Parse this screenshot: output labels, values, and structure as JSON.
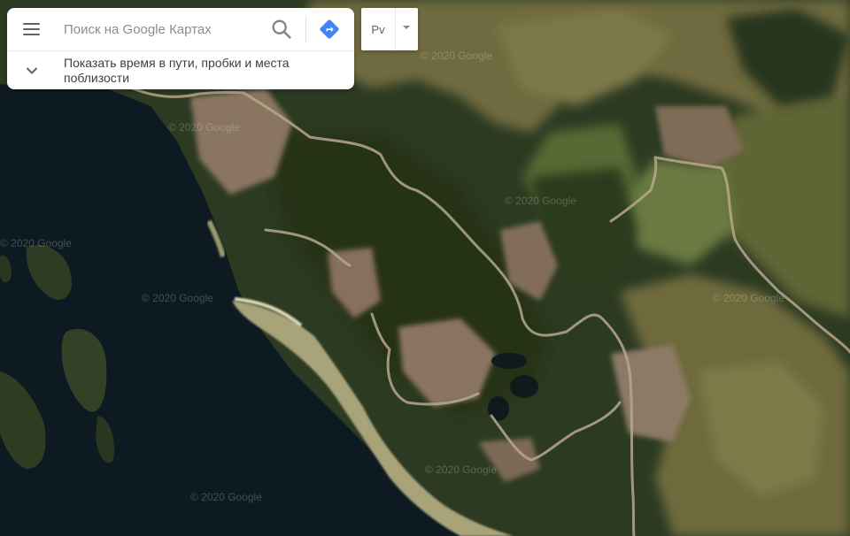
{
  "search": {
    "placeholder": "Поиск на Google Картах"
  },
  "suggestion": {
    "text": "Показать время в пути, пробки и места поблизости"
  },
  "layers": {
    "label": "Рv"
  },
  "watermarks": [
    "© 2020 Google",
    "© 2020 Google",
    "© 2020 Google",
    "© 2020 Google",
    "© 2020 Google",
    "© 2020 Google",
    "© 2020 Google",
    "© 2020 Google"
  ],
  "colors": {
    "water": "#0d1a22",
    "forest": "#2c3a21",
    "meadow": "#7a7346",
    "clearing": "#8a7560",
    "road": "#b7a88c",
    "beach": "#b8b38a",
    "accent": "#4285f4"
  }
}
